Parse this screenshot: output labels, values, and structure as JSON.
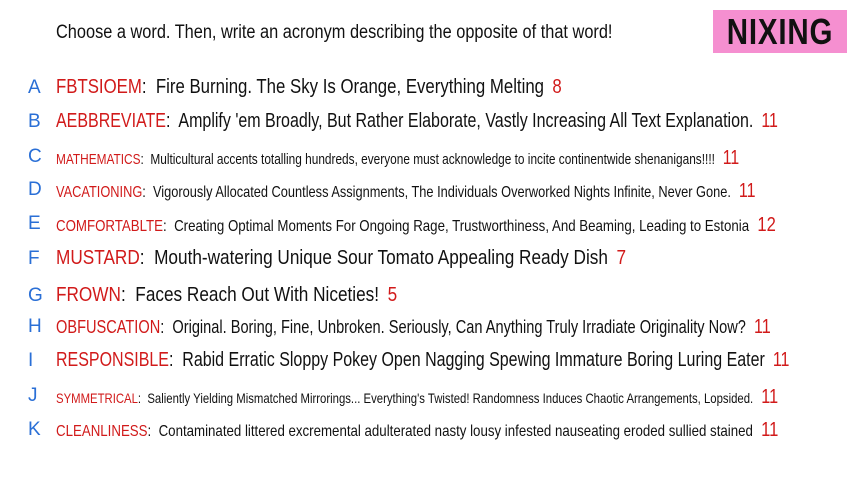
{
  "instructions": "Choose a word. Then, write an acronym describing the opposite of that word!",
  "title": "NIXING",
  "colors": {
    "letter": "#2a6fd6",
    "word": "#d11a1a",
    "count": "#d11a1a",
    "badge": "#f58fd0"
  },
  "rows": [
    {
      "letter": "A",
      "word": "FBTSIOEM",
      "acronym": "Fire Burning. The Sky Is Orange, Everything Melting",
      "count": "8"
    },
    {
      "letter": "B",
      "word": "AEBBREVIATE",
      "acronym": "Amplify 'em Broadly, But Rather Elaborate, Vastly Increasing All Text Explanation.",
      "count": "11"
    },
    {
      "letter": "C",
      "word": "MATHEMATICS",
      "acronym": "Multicultural accents totalling hundreds, everyone must acknowledge to incite continentwide shenanigans!!!!",
      "count": "11"
    },
    {
      "letter": "D",
      "word": "VACATIONING",
      "acronym": "Vigorously Allocated Countless Assignments, The Individuals Overworked Nights Infinite, Never Gone.",
      "count": "11"
    },
    {
      "letter": "E",
      "word": "COMFORTABLTE",
      "acronym": "Creating Optimal Moments For Ongoing Rage, Trustworthiness, And Beaming, Leading to Estonia",
      "count": "12"
    },
    {
      "letter": "F",
      "word": "MUSTARD",
      "acronym": "Mouth-watering Unique Sour Tomato Appealing Ready Dish",
      "count": "7"
    },
    {
      "letter": "G",
      "word": "FROWN",
      "acronym": "Faces Reach Out With Niceties!",
      "count": "5"
    },
    {
      "letter": "H",
      "word": "OBFUSCATION",
      "acronym": "Original. Boring, Fine, Unbroken. Seriously, Can Anything Truly Irradiate Originality Now?",
      "count": "11"
    },
    {
      "letter": "I",
      "word": "RESPONSIBLE",
      "acronym": "Rabid Erratic Sloppy Pokey Open Nagging Spewing Immature Boring Luring Eater",
      "count": "11"
    },
    {
      "letter": "J",
      "word": "SYMMETRICAL",
      "acronym": "Saliently Yielding Mismatched Mirrorings... Everything's Twisted! Randomness Induces Chaotic Arrangements, Lopsided.",
      "count": "11"
    },
    {
      "letter": "K",
      "word": "CLEANLINESS",
      "acronym": "Contaminated littered excremental adulterated nasty lousy infested nauseating eroded sullied stained",
      "count": "11"
    }
  ]
}
